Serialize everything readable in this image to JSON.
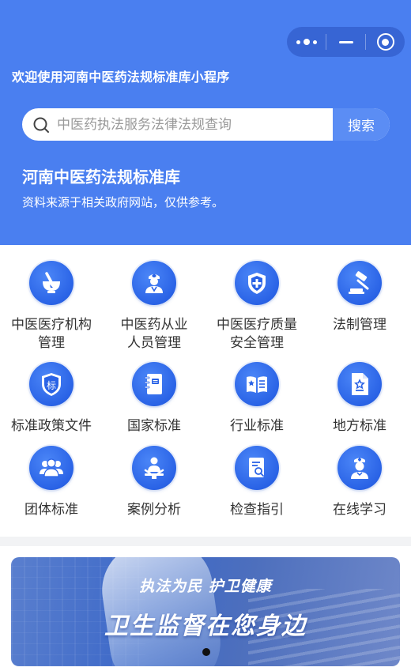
{
  "colors": {
    "header_bg": "#4a7ff0",
    "icon_blue": "#2a63e6",
    "search_button_bg": "#5b8df4",
    "label_text": "#333333"
  },
  "header": {
    "welcome_text": "欢迎使用河南中医药法规标准库小程序"
  },
  "capsule": {
    "more_icon": "more-dots-icon",
    "minimize_icon": "minus-icon",
    "close_icon": "target-icon"
  },
  "search": {
    "placeholder": "中医药执法服务法律法规查询",
    "value": "",
    "button_label": "搜索"
  },
  "library": {
    "title": "河南中医药法规标准库",
    "subtitle": "资料来源于相关政府网站，仅供参考。"
  },
  "grid": {
    "items": [
      {
        "label_line1": "中医医疗机构",
        "label_line2": "管理",
        "icon": "mortar-pestle-icon"
      },
      {
        "label_line1": "中医药从业",
        "label_line2": "人员管理",
        "icon": "doctor-icon"
      },
      {
        "label_line1": "中医医疗质量",
        "label_line2": "安全管理",
        "icon": "shield-plus-icon"
      },
      {
        "label_line1": "法制管理",
        "label_line2": "",
        "icon": "gavel-icon"
      },
      {
        "label_line1": "标准政策文件",
        "label_line2": "",
        "icon": "badge-biao-icon",
        "badge_text": "标"
      },
      {
        "label_line1": "国家标准",
        "label_line2": "",
        "icon": "notebook-icon"
      },
      {
        "label_line1": "行业标准",
        "label_line2": "",
        "icon": "open-book-icon"
      },
      {
        "label_line1": "地方标准",
        "label_line2": "",
        "icon": "document-star-icon"
      },
      {
        "label_line1": "团体标准",
        "label_line2": "",
        "icon": "group-icon"
      },
      {
        "label_line1": "案例分析",
        "label_line2": "",
        "icon": "presenter-icon"
      },
      {
        "label_line1": "检查指引",
        "label_line2": "",
        "icon": "document-search-icon"
      },
      {
        "label_line1": "在线学习",
        "label_line2": "",
        "icon": "nurse-icon"
      }
    ]
  },
  "banner": {
    "slogan_small": "执法为民 护卫健康",
    "slogan_large": "卫生监督在您身边",
    "active_slide": 1,
    "slide_count": 1
  }
}
